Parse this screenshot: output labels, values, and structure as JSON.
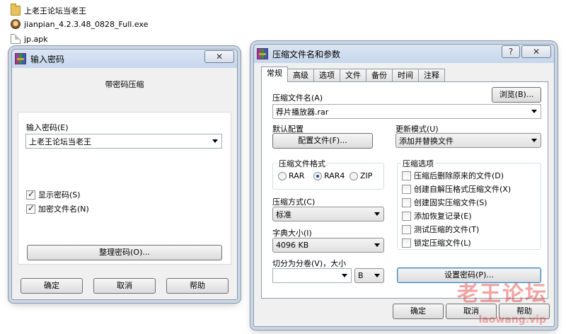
{
  "desktop": {
    "files": [
      {
        "icon": "folder-icon",
        "label": "上老王论坛当老王"
      },
      {
        "icon": "exe-icon",
        "label": "jianpian_4.2.3.48_0828_Full.exe"
      },
      {
        "icon": "apk-file-icon",
        "label": "jp.apk"
      }
    ]
  },
  "password_dialog": {
    "title": "输入密码",
    "close": "✕",
    "heading": "带密码压缩",
    "input_label": "输入密码(E)",
    "input_value": "上老王论坛当老王",
    "show_password": {
      "label": "显示密码(S)",
      "checked": true
    },
    "encrypt_names": {
      "label": "加密文件名(N)",
      "checked": true
    },
    "organize_button": "整理密码(O)...",
    "ok": "确定",
    "cancel": "取消",
    "help": "帮助"
  },
  "archive_dialog": {
    "title": "压缩文件名和参数",
    "help": "?",
    "close": "✕",
    "tabs": [
      "常规",
      "高级",
      "选项",
      "文件",
      "备份",
      "时间",
      "注释"
    ],
    "active_tab": "常规",
    "archive_name_label": "压缩文件名(A)",
    "browse_button": "浏览(B)...",
    "archive_name_value": "荐片播放器.rar",
    "default_profile_label": "默认配置",
    "profiles_button": "配置文件(F)...",
    "update_mode_label": "更新模式(U)",
    "update_mode_value": "添加并替换文件",
    "format_group": "压缩文件格式",
    "formats": [
      {
        "label": "RAR",
        "selected": false
      },
      {
        "label": "RAR4",
        "selected": true
      },
      {
        "label": "ZIP",
        "selected": false
      }
    ],
    "method_label": "压缩方式(C)",
    "method_value": "标准",
    "dict_label": "字典大小(I)",
    "dict_value": "4096 KB",
    "split_label": "切分为分卷(V)，大小",
    "split_value": "",
    "split_unit": "B",
    "options_group": "压缩选项",
    "options": [
      {
        "label": "压缩后删除原来的文件(D)",
        "checked": false
      },
      {
        "label": "创建自解压格式压缩文件(X)",
        "checked": false
      },
      {
        "label": "创建固实压缩文件(S)",
        "checked": false
      },
      {
        "label": "添加恢复记录(E)",
        "checked": false
      },
      {
        "label": "测试压缩的文件(T)",
        "checked": false
      },
      {
        "label": "锁定压缩文件(L)",
        "checked": false
      }
    ],
    "set_password_button": "设置密码(P)...",
    "ok": "确定",
    "cancel": "取消",
    "help_button": "帮助"
  },
  "watermark": {
    "text": "老王论坛",
    "subtext": "laowang.vip"
  }
}
